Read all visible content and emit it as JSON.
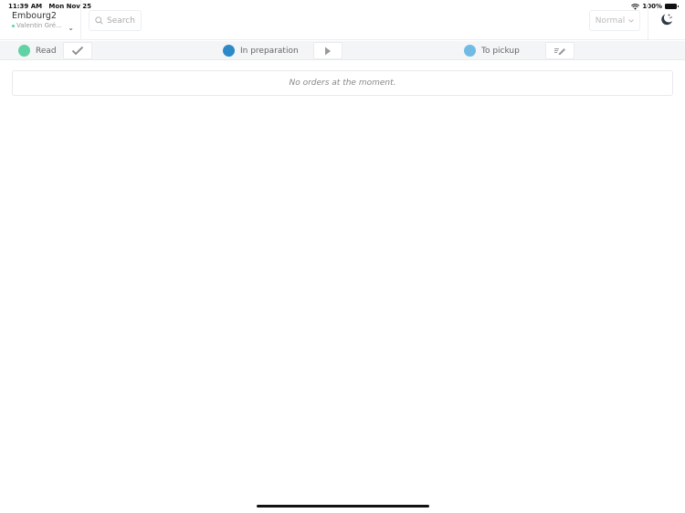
{
  "status_bar": {
    "time": "11:39 AM",
    "date": "Mon Nov 25",
    "battery": "100%",
    "icons": [
      "wifi-icon",
      "battery-icon"
    ]
  },
  "header": {
    "store_name": "Embourg2",
    "user_name": "Valentin Gré...",
    "search_placeholder": "Search",
    "mode_label": "Normal"
  },
  "steps": [
    {
      "label": "Read",
      "color": "#5fd3a4",
      "action_icon": "checkmark-icon"
    },
    {
      "label": "In preparation",
      "color": "#2c8ac8",
      "action_icon": "play-icon"
    },
    {
      "label": "To pickup",
      "color": "#6fbbe4",
      "action_icon": "edit-list-icon"
    }
  ],
  "orders": {
    "empty_message": "No orders at the moment."
  }
}
